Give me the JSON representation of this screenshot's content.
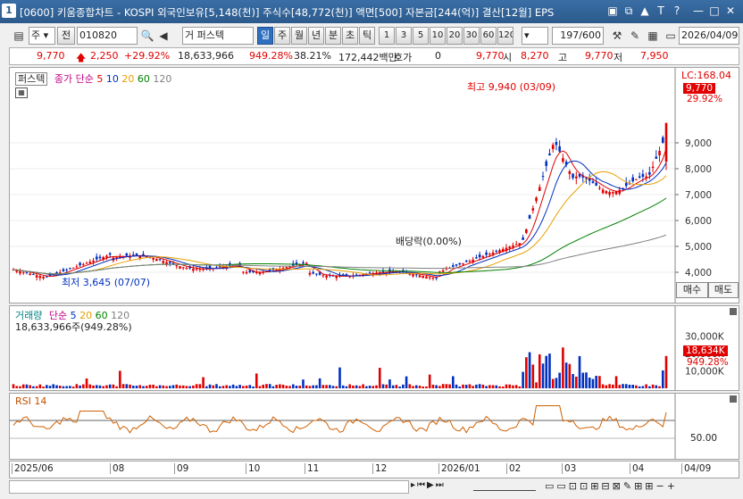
{
  "window": {
    "number": "1",
    "title": "[0600] 키움종합차트 - KOSPI 외국인보유[5,148(천)] 주식수[48,772(천)] 액면[500] 자본금[244(억)] 결산[12월] EPS"
  },
  "toolbar": {
    "type_select": "주",
    "prev_label": "전",
    "code": "010820",
    "stock_name": "퍼스텍",
    "periods": [
      "일",
      "주",
      "월",
      "년",
      "분",
      "초",
      "틱"
    ],
    "selected_period": "일",
    "intervals": [
      "1",
      "3",
      "5",
      "10",
      "20",
      "30",
      "60",
      "120"
    ],
    "count": "197/600",
    "date": "2026/04/09"
  },
  "info": {
    "price": "9,770",
    "change": "2,250",
    "change_pct": "+29.92%",
    "volume": "18,633,966",
    "vol_ratio": "949.28%",
    "turnover": "38.21%",
    "amount": "172,442백만",
    "quote_label": "호가",
    "quote_value": "0",
    "price2": "9,770",
    "open_label": "시",
    "open": "8,270",
    "high_label": "고",
    "high": "9,770",
    "low_label": "저",
    "low": "7,950"
  },
  "price_panel": {
    "stock_tag": "퍼스텍",
    "ma_label": "종가 단순",
    "ma_periods": [
      "5",
      "10",
      "20",
      "60",
      "120"
    ],
    "ma_colors": [
      "#e00000",
      "#0030c0",
      "#e8a000",
      "#008000",
      "#808080"
    ],
    "lc_label": "LC:168.04",
    "last_price_tag": "9,770",
    "last_pct_tag": "29.92%",
    "buy_label": "매수",
    "sell_label": "매도",
    "y_ticks": [
      "9,000",
      "8,000",
      "7,000",
      "6,000",
      "5,000",
      "4,000"
    ],
    "high_annotation": "최고 9,940 (03/09)",
    "low_annotation": "최저 3,645 (07/07)",
    "dividend_annotation": "배당락(0.00%)"
  },
  "volume_panel": {
    "label": "거래량",
    "ma_label": "단순",
    "ma_periods": [
      "5",
      "20",
      "60",
      "120"
    ],
    "summary": "18,633,966주(949.28%)",
    "y_ticks": [
      "30,000K",
      "20,000K",
      "10,000K"
    ],
    "last_tag": "18,634K",
    "last_pct": "949.28%"
  },
  "rsi_panel": {
    "label": "RSI 14",
    "y_tick": "50.00"
  },
  "x_axis": [
    "2025/06",
    "08",
    "09",
    "10",
    "11",
    "12",
    "2026/01",
    "02",
    "03",
    "04",
    "04/09"
  ],
  "colors": {
    "up": "#e00000",
    "down": "#0030c0",
    "titlebar": "#2c5a8c"
  }
}
